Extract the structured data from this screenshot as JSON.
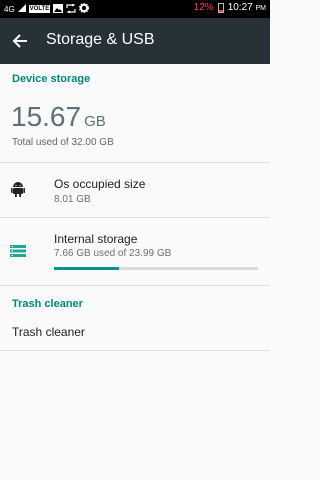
{
  "status_bar": {
    "network": "4G",
    "volte": "VOLTE",
    "battery_pct": "12%",
    "time": "10:27",
    "ampm": "PM",
    "icons": [
      "signal-icon",
      "image-icon",
      "sync-icon",
      "settings-gear-icon"
    ]
  },
  "app_bar": {
    "title": "Storage & USB",
    "back_icon": "arrow-back-icon"
  },
  "device_storage": {
    "header": "Device storage",
    "used_value": "15.67",
    "used_unit": "GB",
    "total_text": "Total used of 32.00 GB"
  },
  "items": [
    {
      "icon": "android-icon",
      "title": "Os occupied size",
      "subtitle": "8.01 GB"
    },
    {
      "icon": "storage-icon",
      "title": "Internal storage",
      "subtitle": "7.66 GB used of 23.99 GB",
      "progress": 0.32
    }
  ],
  "trash": {
    "header": "Trash cleaner",
    "item": "Trash cleaner"
  },
  "colors": {
    "accent": "#00897b",
    "app_bar": "#263238",
    "progress": "#009688"
  }
}
